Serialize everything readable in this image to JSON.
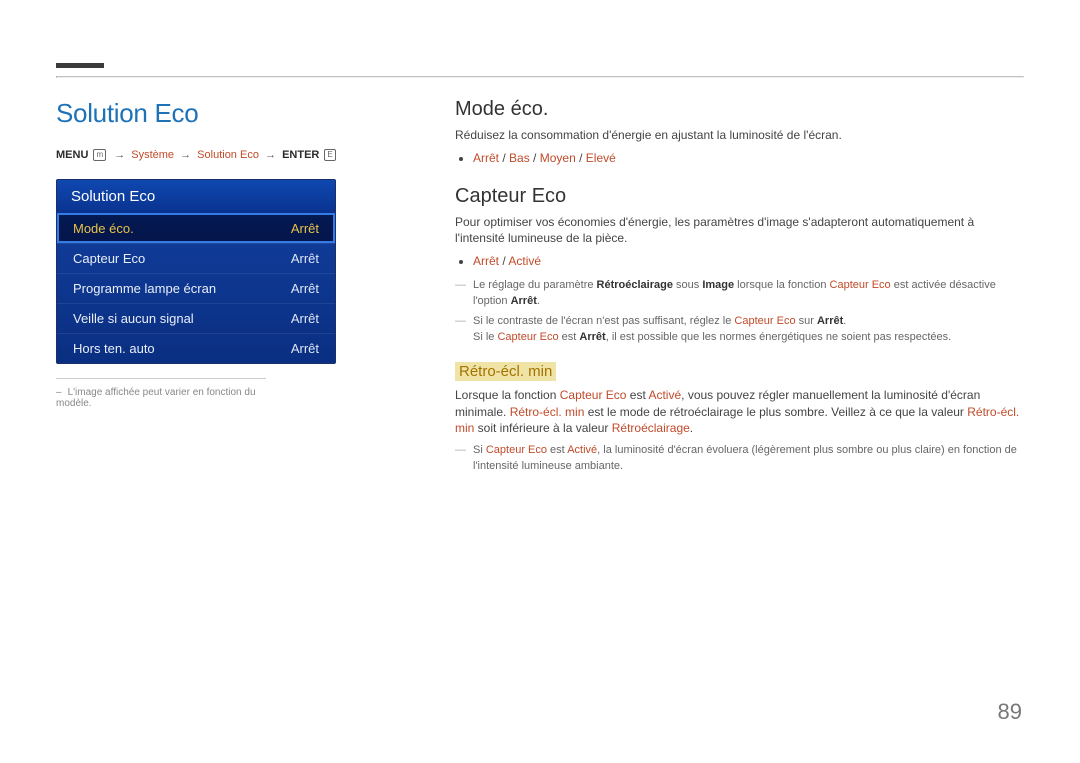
{
  "pageNumber": "89",
  "left": {
    "title": "Solution Eco",
    "path": {
      "menu": "MENU",
      "arrow": "→",
      "system": "Système",
      "solution": "Solution Eco",
      "enter": "ENTER"
    },
    "menu": {
      "header": "Solution Eco",
      "items": [
        {
          "label": "Mode éco.",
          "value": "Arrêt",
          "selected": true
        },
        {
          "label": "Capteur Eco",
          "value": "Arrêt"
        },
        {
          "label": "Programme lampe écran",
          "value": "Arrêt"
        },
        {
          "label": "Veille si aucun signal",
          "value": "Arrêt"
        },
        {
          "label": "Hors ten. auto",
          "value": "Arrêt"
        }
      ]
    },
    "note": "L'image affichée peut varier en fonction du modèle."
  },
  "right": {
    "sec1": {
      "heading": "Mode éco.",
      "desc": "Réduisez la consommation d'énergie en ajustant la luminosité de l'écran.",
      "opts": [
        "Arrêt",
        "Bas",
        "Moyen",
        "Elevé"
      ]
    },
    "sec2": {
      "heading": "Capteur Eco",
      "desc": "Pour optimiser vos économies d'énergie, les paramètres d'image s'adapteront automatiquement à l'intensité lumineuse de la pièce.",
      "opts": [
        "Arrêt",
        "Activé"
      ],
      "dash1_pre": "Le réglage du paramètre ",
      "dash1_b": "Rétroéclairage",
      "dash1_mid": " sous ",
      "dash1_b2": "Image",
      "dash1_mid2": " lorsque la fonction ",
      "dash1_t": "Capteur Eco",
      "dash1_post": " est activée désactive l'option ",
      "dash1_off": "Arrêt",
      "dash1_end": ".",
      "dash2_pre": "Si le contraste de l'écran n'est pas suffisant, réglez le ",
      "dash2_t": "Capteur Eco",
      "dash2_mid": " sur ",
      "dash2_b": "Arrêt",
      "dash2_end": ".",
      "dash2_l2a": "Si le ",
      "dash2_l2t": "Capteur Eco",
      "dash2_l2b": " est ",
      "dash2_l2c": "Arrêt",
      "dash2_l2d": ", il est possible que les normes énergétiques ne soient pas respectées."
    },
    "sec3": {
      "heading": "Rétro-écl. min",
      "p1a": "Lorsque la fonction ",
      "p1t": "Capteur Eco",
      "p1b": " est ",
      "p1v": "Activé",
      "p1c": ", vous pouvez régler manuellement la luminosité d'écran minimale. ",
      "p1d": "Rétro-écl. min",
      "p1e": " est le mode de rétroéclairage le plus sombre. Veillez à ce que la valeur ",
      "p1f": "Rétro-écl. min",
      "p1g": " soit inférieure à la valeur ",
      "p1h": "Rétroéclairage",
      "p1i": ".",
      "dash_a": "Si ",
      "dash_t": "Capteur Eco",
      "dash_b": " est ",
      "dash_v": "Activé",
      "dash_c": ", la luminosité d'écran évoluera (légèrement plus sombre ou plus claire) en fonction de l'intensité lumineuse ambiante."
    }
  }
}
